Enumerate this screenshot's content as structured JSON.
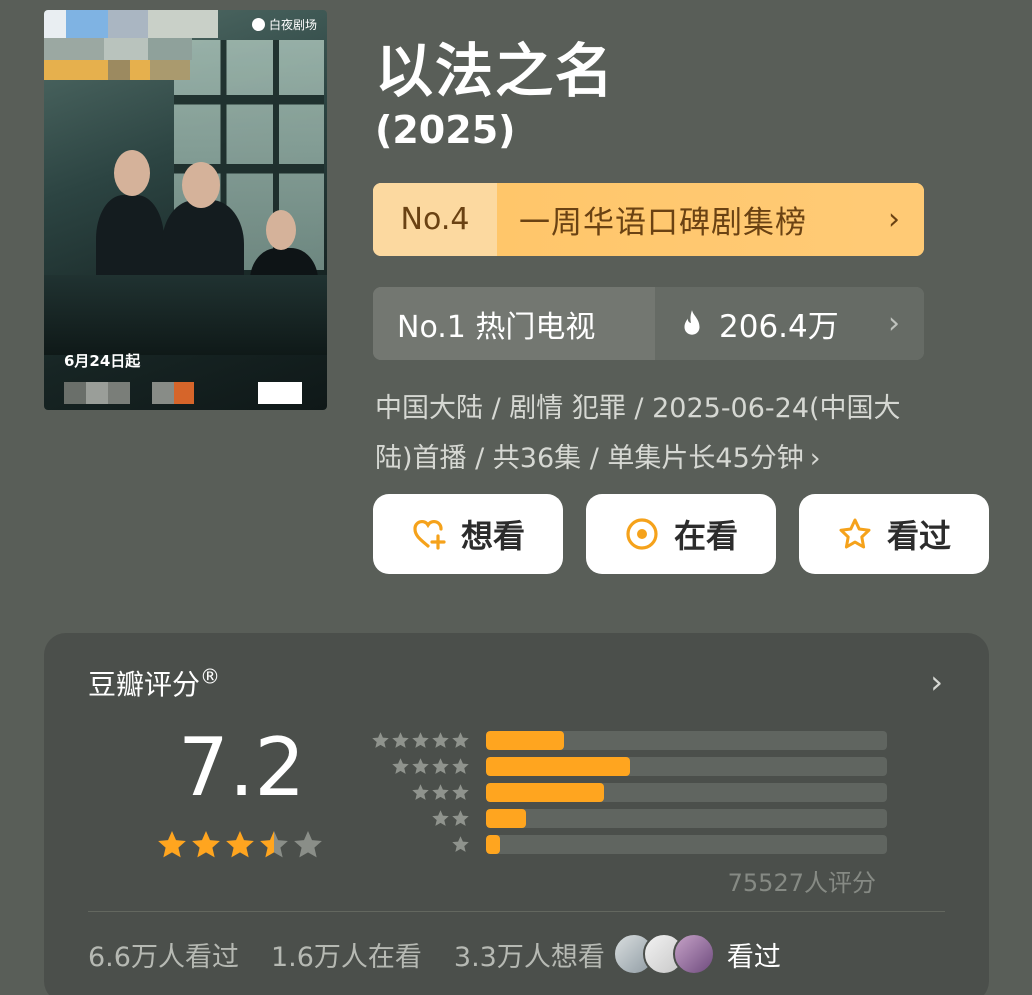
{
  "poster": {
    "logo_text": "白夜剧场",
    "date_text": "6月24日起"
  },
  "header": {
    "title": "以法之名",
    "year": "(2025)"
  },
  "rankings": [
    {
      "rank": "No.4",
      "label": "一周华语口碑剧集榜",
      "chevron": "›"
    },
    {
      "rank": "No.1 热门电视",
      "hot_value": "206.4万",
      "chevron": "›"
    }
  ],
  "meta": {
    "line1": "中国大陆 / 剧情 犯罪 / 2025-06-24(中国大",
    "line2": "陆)首播 / 共36集 / 单集片长45分钟",
    "chevron": "›"
  },
  "actions": [
    {
      "label": "想看",
      "icon": "heart-plus-icon"
    },
    {
      "label": "在看",
      "icon": "target-circle-icon"
    },
    {
      "label": "看过",
      "icon": "star-outline-icon"
    }
  ],
  "rating": {
    "title": "豆瓣评分",
    "registered_mark": "®",
    "chevron": "›",
    "score": "7.2",
    "stars_value": 3.5,
    "distribution": [
      {
        "stars": 5,
        "fraction": 0.195
      },
      {
        "stars": 4,
        "fraction": 0.36
      },
      {
        "stars": 3,
        "fraction": 0.295
      },
      {
        "stars": 2,
        "fraction": 0.1
      },
      {
        "stars": 1,
        "fraction": 0.035
      }
    ],
    "count_text": "75527人评分",
    "footer": {
      "watched": "6.6万人看过",
      "watching": "1.6万人在看",
      "want": "3.3万人想看",
      "friends_label": "看过"
    }
  },
  "colors": {
    "background": "#595e58",
    "accent_orange": "#ffa51f",
    "rank_orange_bg": "#ffc66a",
    "card_bg": "#4b4f4b"
  }
}
